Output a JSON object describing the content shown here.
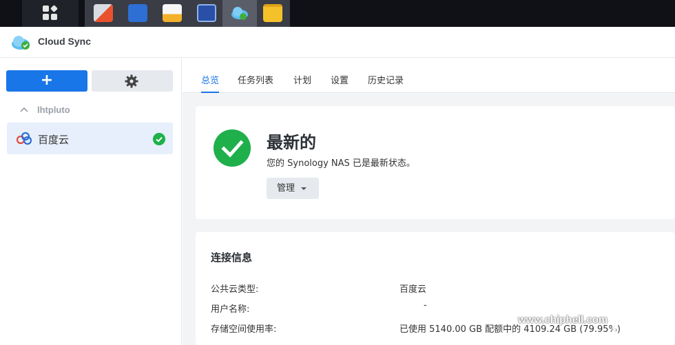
{
  "app": {
    "title": "Cloud Sync"
  },
  "taskbar": {
    "apps": [
      {
        "icon": "storage-manager-icon",
        "color": "#e9522c"
      },
      {
        "icon": "control-panel-icon",
        "color": "#2d6fd4"
      },
      {
        "icon": "package-center-icon",
        "color": "#f3b12b"
      },
      {
        "icon": "resource-monitor-icon",
        "color": "#2a4fa7"
      },
      {
        "icon": "cloud-sync-icon",
        "color": "#4ab0e8",
        "active": true
      },
      {
        "icon": "file-station-icon",
        "color": "#f5c12b"
      }
    ]
  },
  "sidebar": {
    "add_label": "+",
    "group_label": "lhtpluto",
    "items": [
      {
        "label": "百度云",
        "status": "ok"
      }
    ]
  },
  "tabs": [
    {
      "label": "总览",
      "active": true
    },
    {
      "label": "任务列表"
    },
    {
      "label": "计划"
    },
    {
      "label": "设置"
    },
    {
      "label": "历史记录"
    }
  ],
  "status": {
    "title": "最新的",
    "description": "您的 Synology NAS 已是最新状态。",
    "manage_label": "管理"
  },
  "connection": {
    "title": "连接信息",
    "rows": [
      {
        "label": "公共云类型:",
        "value": "百度云"
      },
      {
        "label": "用户名称:",
        "value": "-"
      },
      {
        "label": "存储空间使用率:",
        "value": "已使用 5140.00 GB 配额中的 4109.24 GB (79.95%)"
      }
    ]
  },
  "watermark": {
    "text": "www.chiphell.com",
    "logo": "chip hell"
  },
  "colors": {
    "accent": "#1976e8",
    "ok": "#1fb04b"
  }
}
